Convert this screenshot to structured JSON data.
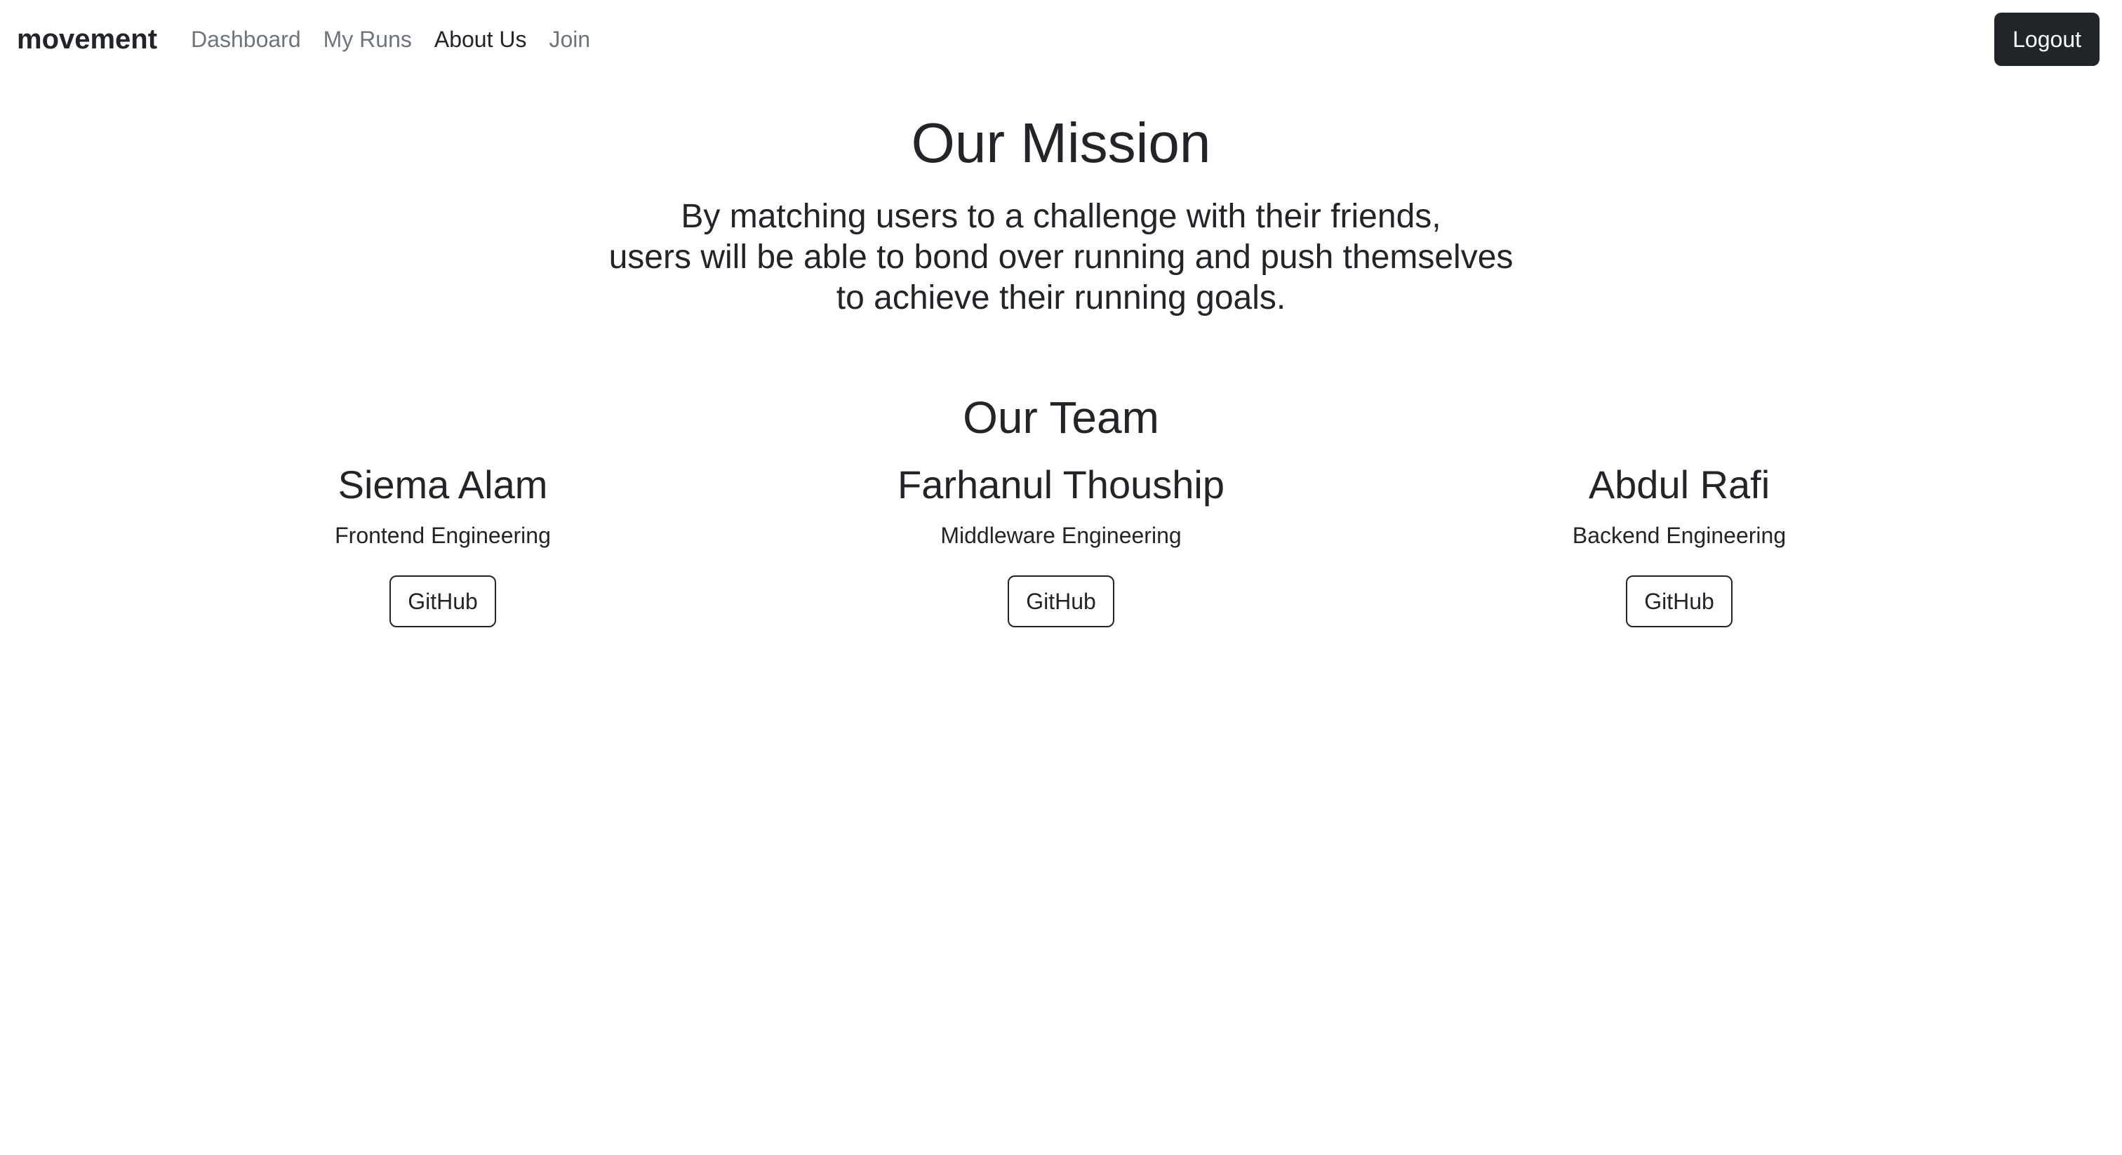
{
  "nav": {
    "brand": "movement",
    "links": [
      {
        "label": "Dashboard",
        "active": false
      },
      {
        "label": "My Runs",
        "active": false
      },
      {
        "label": "About Us",
        "active": true
      },
      {
        "label": "Join",
        "active": false
      }
    ],
    "logout_label": "Logout"
  },
  "mission": {
    "title": "Our Mission",
    "lines": [
      "By matching users to a challenge with their friends,",
      "users will be able to bond over running and push themselves",
      "to achieve their running goals."
    ]
  },
  "team": {
    "title": "Our Team",
    "members": [
      {
        "name": "Siema Alam",
        "role": "Frontend Engineering",
        "button": "GitHub"
      },
      {
        "name": "Farhanul Thouship",
        "role": "Middleware Engineering",
        "button": "GitHub"
      },
      {
        "name": "Abdul Rafi",
        "role": "Backend Engineering",
        "button": "GitHub"
      }
    ]
  },
  "colors": {
    "text": "#212529",
    "muted": "#6c757d",
    "dark_button": "#212529",
    "background": "#ffffff"
  }
}
